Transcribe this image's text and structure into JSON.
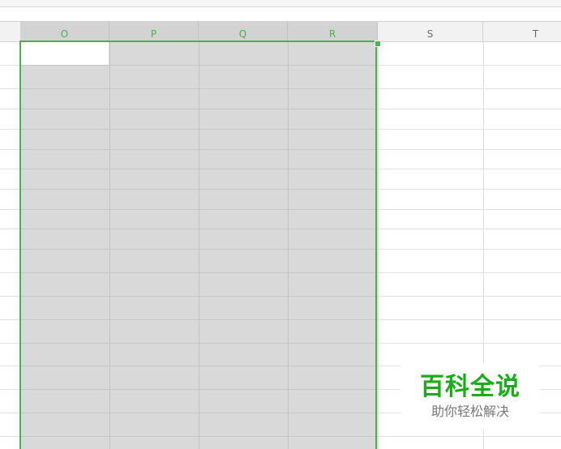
{
  "column_headers": [
    {
      "label": "O",
      "selected": true
    },
    {
      "label": "P",
      "selected": true
    },
    {
      "label": "Q",
      "selected": true
    },
    {
      "label": "R",
      "selected": true
    },
    {
      "label": "S",
      "selected": false
    },
    {
      "label": "T",
      "selected": false
    }
  ],
  "selection": {
    "columns": [
      "O",
      "P",
      "Q",
      "R"
    ],
    "color": "#4caf50"
  },
  "watermark": {
    "title": "百科全说",
    "subtitle": "助你轻松解决",
    "title_color": "#1aad19"
  }
}
